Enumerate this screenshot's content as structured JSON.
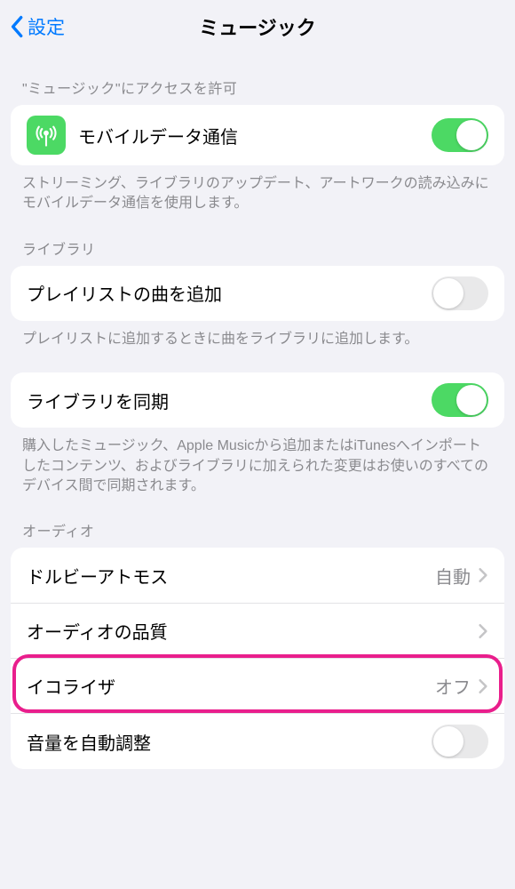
{
  "header": {
    "back_label": "設定",
    "title": "ミュージック"
  },
  "section_access": {
    "label": "\"ミュージック\"にアクセスを許可",
    "cellular": {
      "label": "モバイルデータ通信",
      "enabled": true
    },
    "footer": "ストリーミング、ライブラリのアップデート、アートワークの読み込みにモバイルデータ通信を使用します。"
  },
  "section_library": {
    "label": "ライブラリ",
    "add_playlist": {
      "label": "プレイリストの曲を追加",
      "enabled": false
    },
    "add_playlist_footer": "プレイリストに追加するときに曲をライブラリに追加します。",
    "sync_library": {
      "label": "ライブラリを同期",
      "enabled": true
    },
    "sync_footer": "購入したミュージック、Apple Musicから追加またはiTunesへインポートしたコンテンツ、およびライブラリに加えられた変更はお使いのすべてのデバイス間で同期されます。"
  },
  "section_audio": {
    "label": "オーディオ",
    "dolby": {
      "label": "ドルビーアトモス",
      "value": "自動"
    },
    "quality": {
      "label": "オーディオの品質",
      "value": ""
    },
    "eq": {
      "label": "イコライザ",
      "value": "オフ"
    },
    "sound_check": {
      "label": "音量を自動調整",
      "enabled": false
    }
  }
}
